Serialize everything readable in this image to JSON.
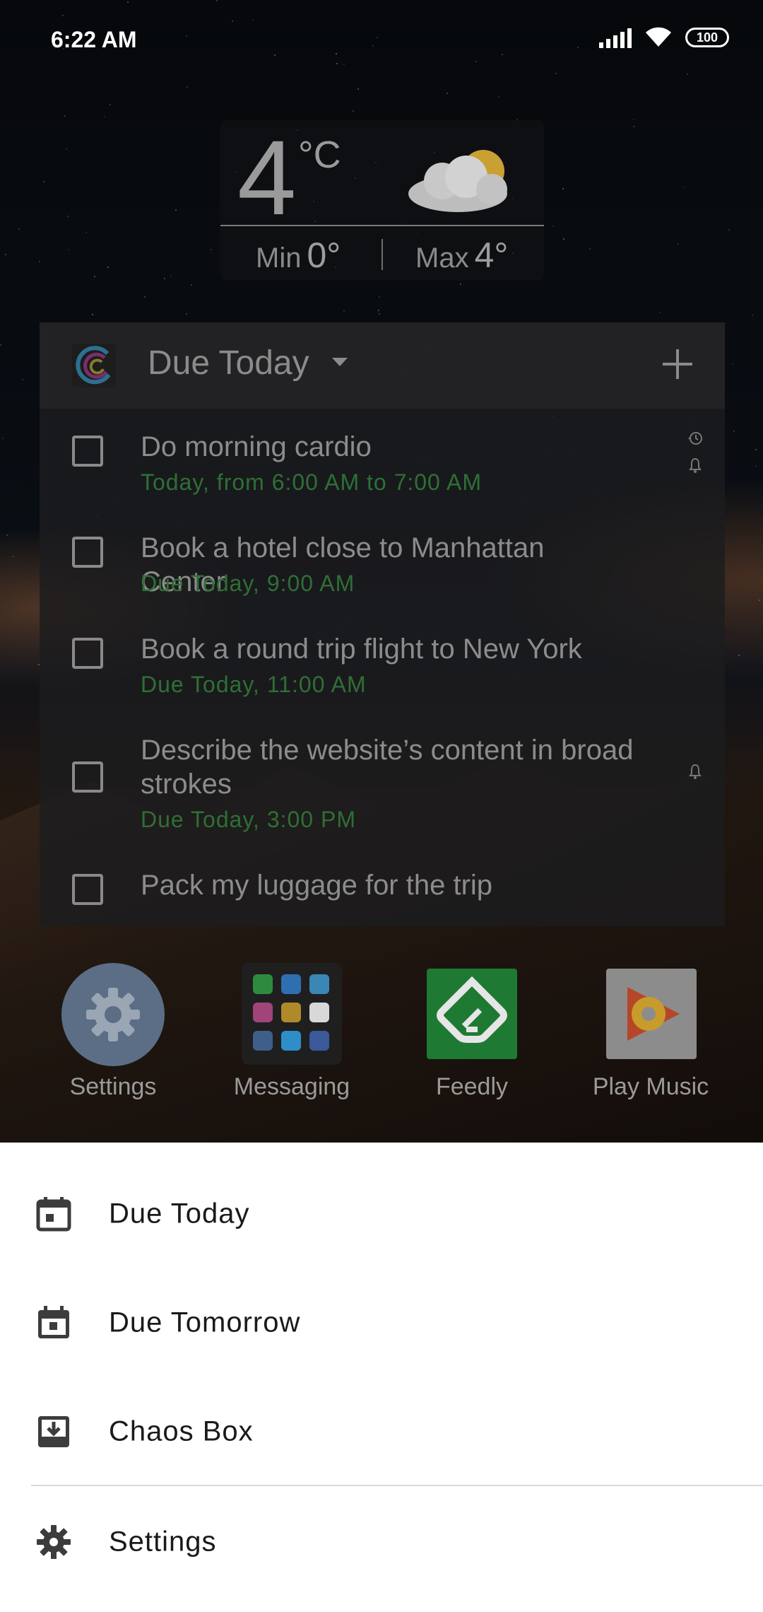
{
  "status_bar": {
    "time": "6:22 AM",
    "battery": "100",
    "icons": [
      "signal-icon",
      "wifi-icon",
      "battery-icon"
    ]
  },
  "weather": {
    "temperature": "4",
    "unit": "°C",
    "min_label": "Min",
    "min_value": "0°",
    "max_label": "Max",
    "max_value": "4°",
    "icon": "partly-cloudy-icon"
  },
  "task_widget": {
    "title": "Due Today",
    "tasks": [
      {
        "title": "Do morning cardio",
        "due": "Today, from 6:00 AM to 7:00 AM",
        "has_recurrence": true,
        "has_reminder": true
      },
      {
        "title": "Book a hotel close to Manhattan Center",
        "due": "Due Today, 9:00 AM",
        "has_recurrence": false,
        "has_reminder": false
      },
      {
        "title": "Book a round trip flight to New York",
        "due": "Due Today, 11:00 AM",
        "has_recurrence": false,
        "has_reminder": false
      },
      {
        "title": "Describe the website’s content in broad strokes",
        "due": "Due Today, 3:00 PM",
        "has_recurrence": false,
        "has_reminder": true
      },
      {
        "title": "Pack my luggage for the trip",
        "due": "",
        "has_recurrence": false,
        "has_reminder": false
      }
    ],
    "colors": {
      "due_text": "#2f6f35"
    }
  },
  "dock": {
    "apps": [
      {
        "label": "Settings",
        "icon": "gear-icon"
      },
      {
        "label": "Messaging",
        "icon": "messaging-folder-icon"
      },
      {
        "label": "Feedly",
        "icon": "feedly-icon"
      },
      {
        "label": "Play Music",
        "icon": "play-music-icon"
      }
    ]
  },
  "sheet": {
    "items": [
      {
        "label": "Due Today",
        "icon": "calendar-today-icon"
      },
      {
        "label": "Due Tomorrow",
        "icon": "calendar-tomorrow-icon"
      },
      {
        "label": "Chaos Box",
        "icon": "inbox-download-icon"
      },
      {
        "label": "Settings",
        "icon": "gear-icon"
      }
    ]
  }
}
